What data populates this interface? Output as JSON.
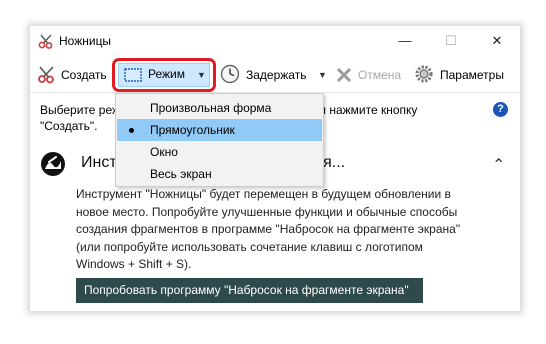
{
  "window": {
    "title": "Ножницы",
    "minimize": "—",
    "maximize": "☐",
    "close": "✕"
  },
  "toolbar": {
    "new_label": "Создать",
    "mode_label": "Режим",
    "delay_label": "Задержать",
    "cancel_label": "Отмена",
    "options_label": "Параметры",
    "dropdown_glyph": "▼"
  },
  "hint": {
    "line1_start": "Выберите реж",
    "line1_end": "им\" или нажмите кнопку",
    "line2": "\"Создать\".",
    "help_glyph": "?"
  },
  "notice": {
    "title_start": "Инст",
    "title_end": "ается...",
    "collapse_glyph": "⌃",
    "body": "Инструмент \"Ножницы\" будет перемещен в будущем обновлении в новое место. Попробуйте улучшенные функции и обычные способы создания фрагментов в программе \"Набросок на фрагменте экрана\" (или попробуйте использовать сочетание клавиш с логотипом Windows + Shift + S).",
    "button": "Попробовать программу \"Набросок на фрагменте экрана\""
  },
  "mode_menu": {
    "items": [
      {
        "label": "Произвольная форма"
      },
      {
        "label": "Прямоугольник"
      },
      {
        "label": "Окно"
      },
      {
        "label": "Весь экран"
      }
    ],
    "selected": "Прямоугольник"
  },
  "colors": {
    "highlight_ring": "#e21b23",
    "menu_selected": "#91c9f7",
    "button_bg": "#2e4a4c",
    "help_icon": "#1a56b8"
  }
}
